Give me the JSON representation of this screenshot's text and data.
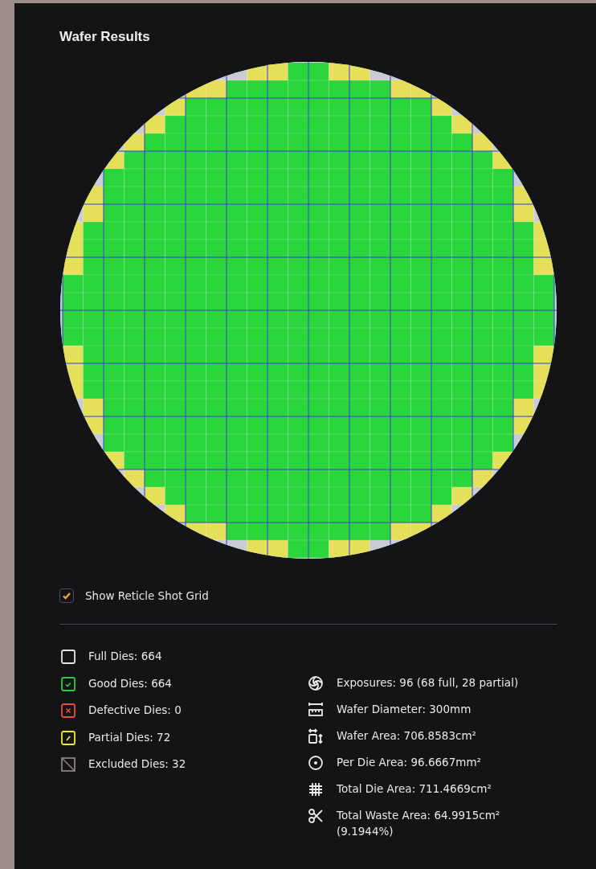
{
  "title": "Wafer Results",
  "reticle_grid": {
    "label": "Show Reticle Shot Grid",
    "checked": true
  },
  "legend": [
    {
      "kind": "full",
      "label": "Full Dies: 664"
    },
    {
      "kind": "good",
      "label": "Good Dies: 664"
    },
    {
      "kind": "defective",
      "label": "Defective Dies: 0"
    },
    {
      "kind": "partial",
      "label": "Partial Dies: 72"
    },
    {
      "kind": "excluded",
      "label": "Excluded Dies: 32"
    }
  ],
  "stats": [
    {
      "kind": "exposures",
      "label": "Exposures: 96 (68 full, 28 partial)"
    },
    {
      "kind": "diameter",
      "label": "Wafer Diameter: 300mm"
    },
    {
      "kind": "wafer_area",
      "label": "Wafer Area: 706.8583cm²"
    },
    {
      "kind": "die_area",
      "label": "Per Die Area: 96.6667mm²"
    },
    {
      "kind": "total_die_area",
      "label": "Total Die Area: 711.4669cm²"
    },
    {
      "kind": "waste_area",
      "label": "Total Waste Area: 64.9915cm² (9.1944%)"
    }
  ]
}
